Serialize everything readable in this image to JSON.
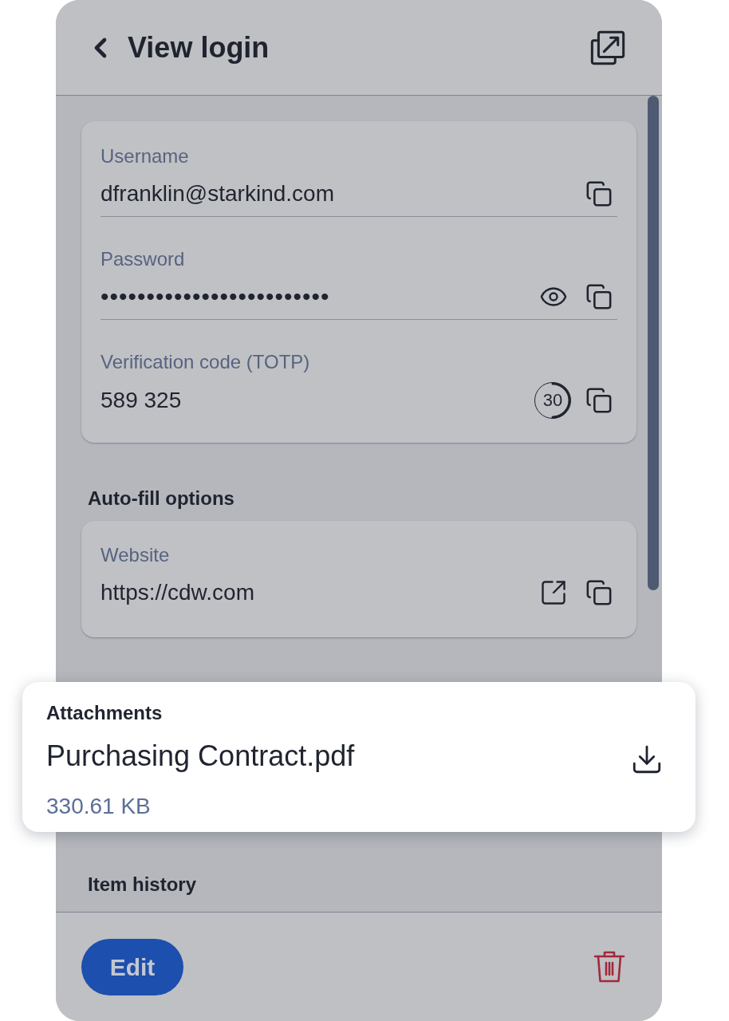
{
  "header": {
    "title": "View login"
  },
  "login_card": {
    "fields": [
      {
        "kind": "text",
        "label": "Username",
        "value": "dfranklin@starkind.com"
      },
      {
        "kind": "password",
        "label": "Password",
        "value": "•••••••••••••••••••••••••"
      },
      {
        "kind": "totp",
        "label": "Verification code (TOTP)",
        "value": "589 325",
        "countdown": "30",
        "level": 0.5
      }
    ]
  },
  "autofill": {
    "heading": "Auto-fill options",
    "fields": [
      {
        "kind": "url",
        "label": "Website",
        "value": "https://cdw.com"
      }
    ]
  },
  "attachments": {
    "heading": "Attachments",
    "items": [
      {
        "name": "Purchasing Contract.pdf",
        "size": "330.61 KB"
      }
    ]
  },
  "item_history": {
    "heading": "Item history"
  },
  "footer": {
    "edit_button": "Edit"
  }
}
